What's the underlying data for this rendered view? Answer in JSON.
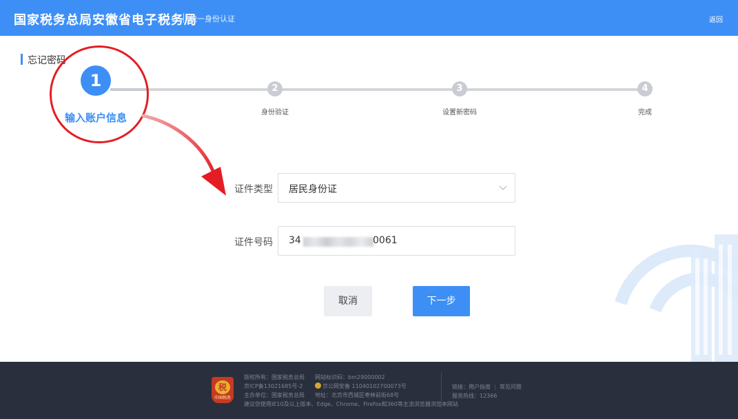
{
  "header": {
    "title": "国家税务总局安徽省电子税务局",
    "subtitle": "统一身份认证",
    "back_label": "返回"
  },
  "page": {
    "heading": "忘记密码"
  },
  "steps": [
    {
      "number": "1",
      "label": "输入账户信息"
    },
    {
      "number": "2",
      "label": "身份验证"
    },
    {
      "number": "3",
      "label": "设置新密码"
    },
    {
      "number": "4",
      "label": "完成"
    }
  ],
  "form": {
    "id_type_label": "证件类型",
    "id_type_value": "居民身份证",
    "id_number_label": "证件号码",
    "id_number_prefix": "34",
    "id_number_suffix": "0061"
  },
  "buttons": {
    "cancel": "取消",
    "next": "下一步"
  },
  "footer": {
    "copyright": "版权所有：国家税务总局",
    "site_code": "网站标识码：bm29000002",
    "icp": "京ICP备13021685号-2",
    "police": "京公网安备 11040102700073号",
    "sponsor": "主办单位：国家税务总局",
    "address": "地址：北京市西城区枣林前街68号",
    "browser_tip": "建议您使用IE10及以上版本、Edge、Chrome、Firefox和360等主流浏览器浏览本网站",
    "links_label": "链接：",
    "user_guide": "用户指南",
    "faq": "常见问题",
    "hotline": "服务热线：12366",
    "emblem_text": "中国税务"
  },
  "colors": {
    "brand": "#3d8ff6",
    "annotation": "#e41d24",
    "footer_bg": "#2a2f3d"
  }
}
